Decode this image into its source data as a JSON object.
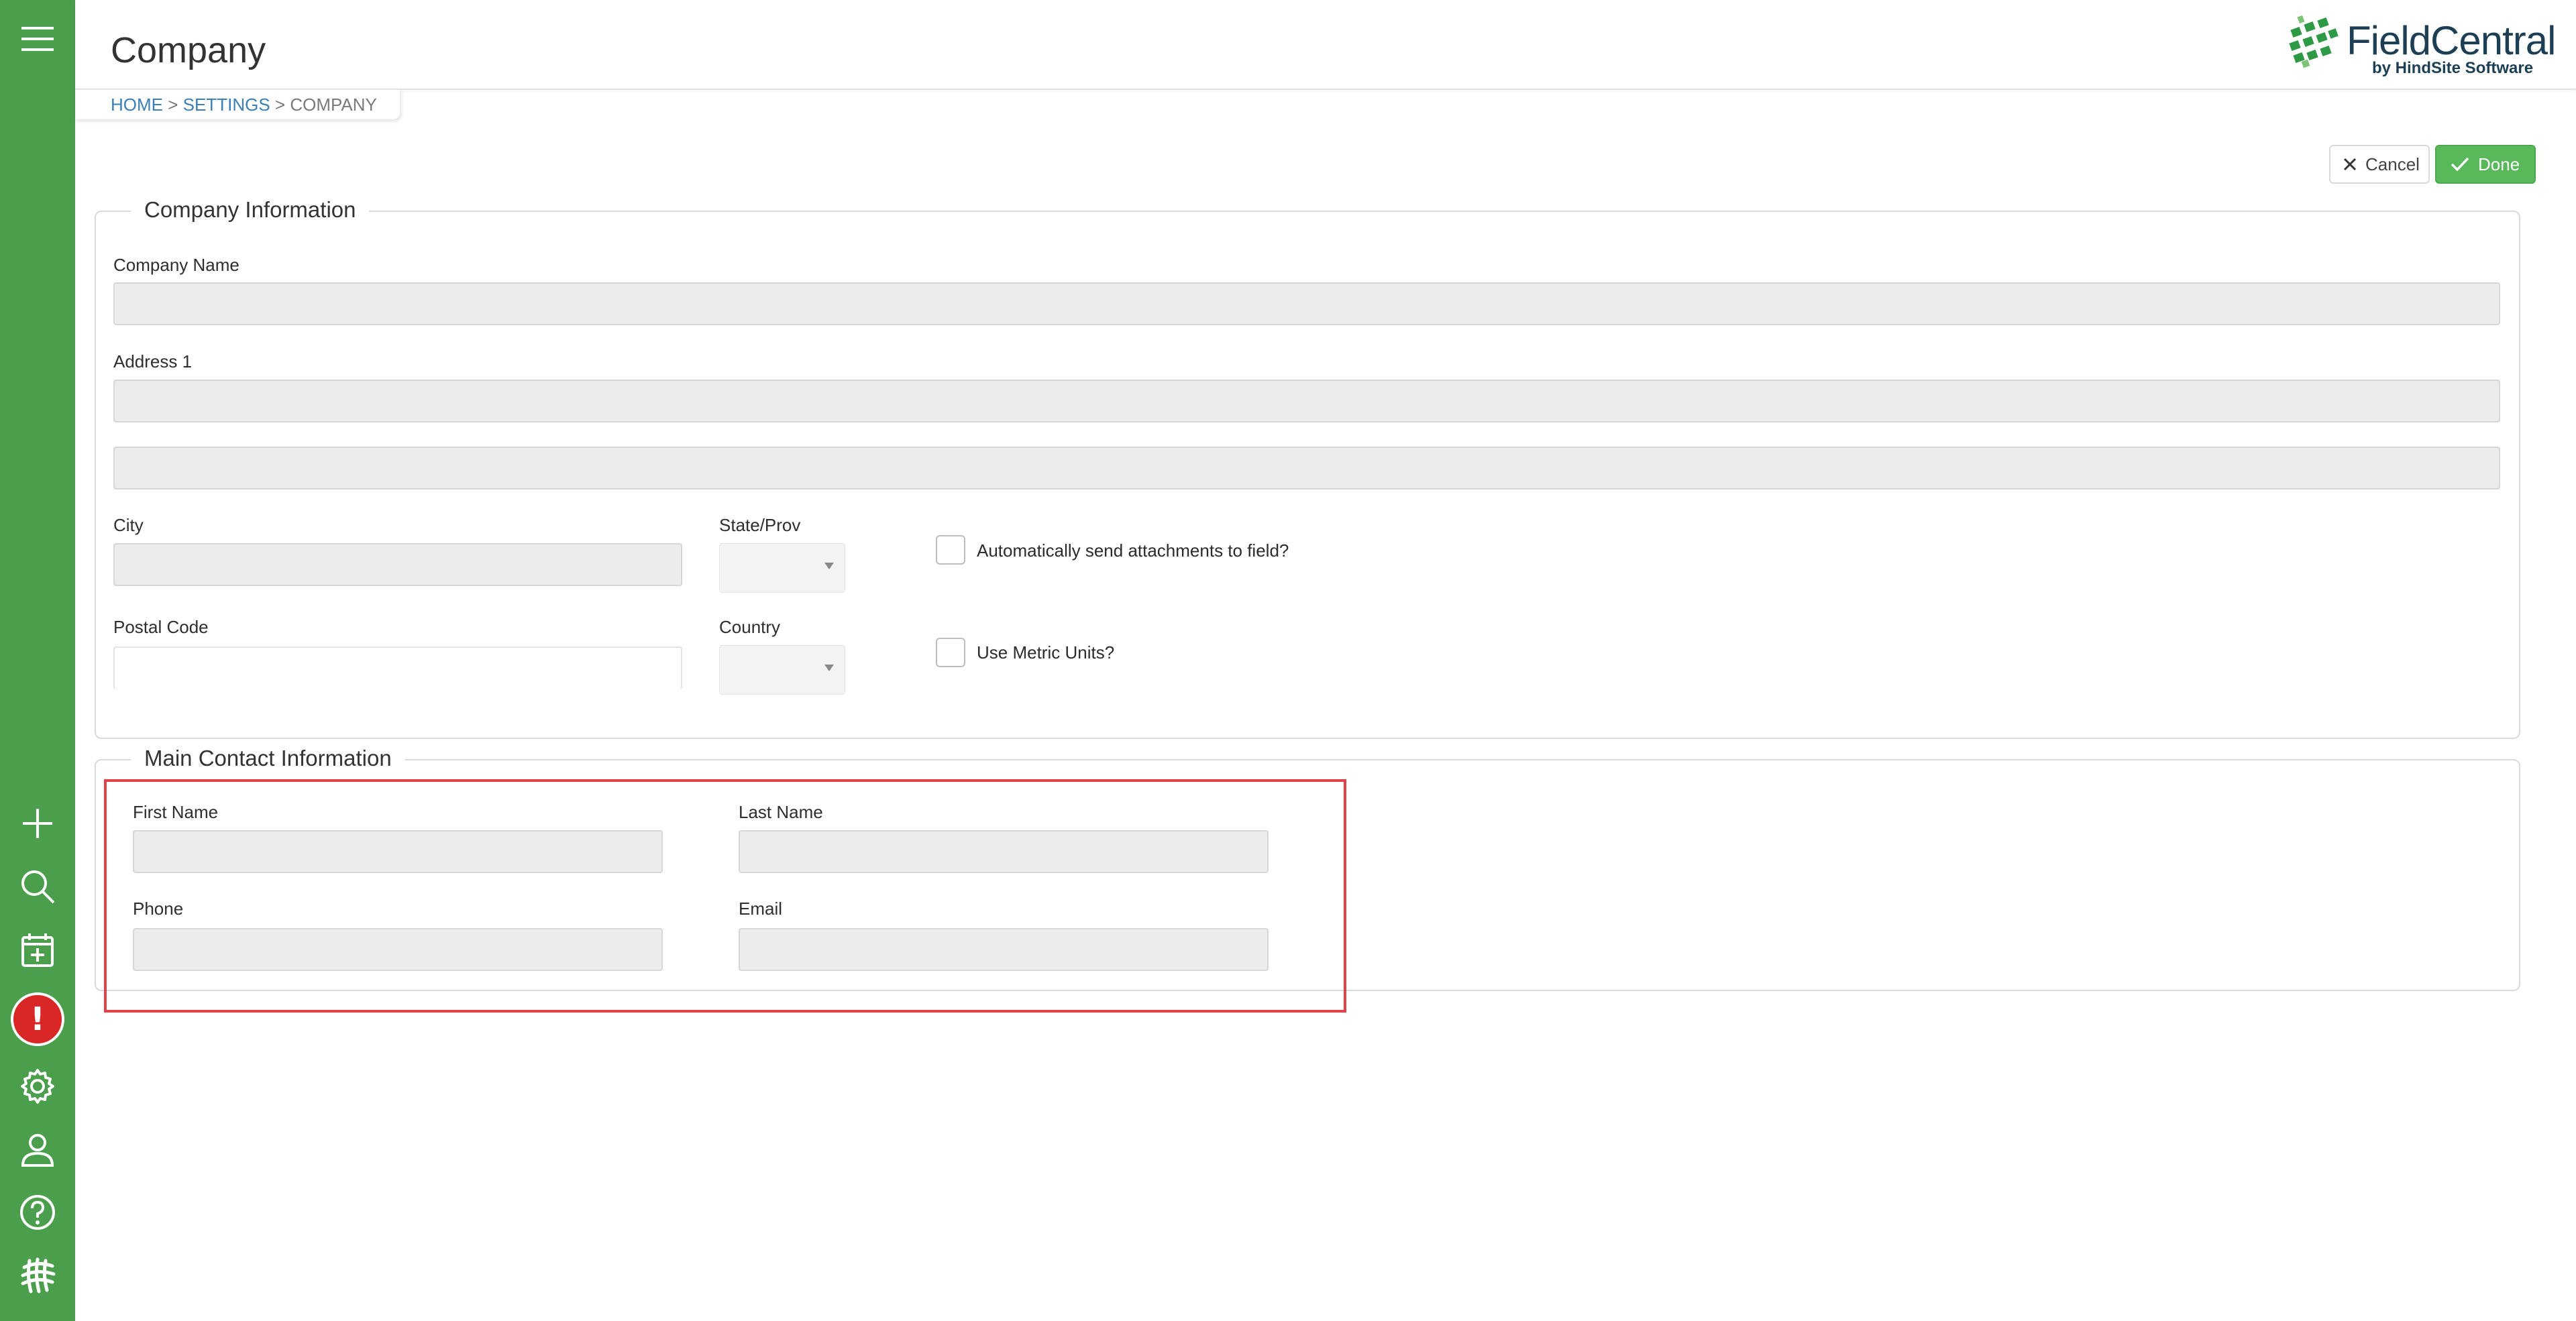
{
  "header": {
    "title": "Company",
    "logo_text": "FieldCentral",
    "logo_subtext": "by HindSite Software"
  },
  "breadcrumb": {
    "items": [
      "HOME",
      "SETTINGS",
      "COMPANY"
    ],
    "separator": ">"
  },
  "actions": {
    "cancel_label": "Cancel",
    "done_label": "Done"
  },
  "sidebar": {
    "icons": [
      "menu-icon",
      "add-icon",
      "search-icon",
      "calendar-add-icon",
      "alert-icon",
      "settings-icon",
      "user-icon",
      "help-icon",
      "fieldcentral-logo-icon"
    ]
  },
  "company_info": {
    "legend": "Company Information",
    "company_name_label": "Company Name",
    "company_name_value": "",
    "address1_label": "Address 1",
    "address1_value": "",
    "address2_value": "",
    "city_label": "City",
    "city_value": "",
    "state_label": "State/Prov",
    "state_value": "",
    "postal_label": "Postal Code",
    "postal_value": "",
    "country_label": "Country",
    "country_value": "",
    "auto_attach_label": "Automatically send attachments to field?",
    "auto_attach_checked": false,
    "metric_label": "Use Metric Units?",
    "metric_checked": false
  },
  "main_contact": {
    "legend": "Main Contact Information",
    "first_name_label": "First Name",
    "first_name_value": "",
    "last_name_label": "Last Name",
    "last_name_value": "",
    "phone_label": "Phone",
    "phone_value": "",
    "email_label": "Email",
    "email_value": ""
  },
  "colors": {
    "sidebar": "#4a9e4c",
    "done_button": "#58b85a",
    "alert": "#d92626",
    "link": "#3a7fb8",
    "highlight_box": "#e0434b"
  }
}
